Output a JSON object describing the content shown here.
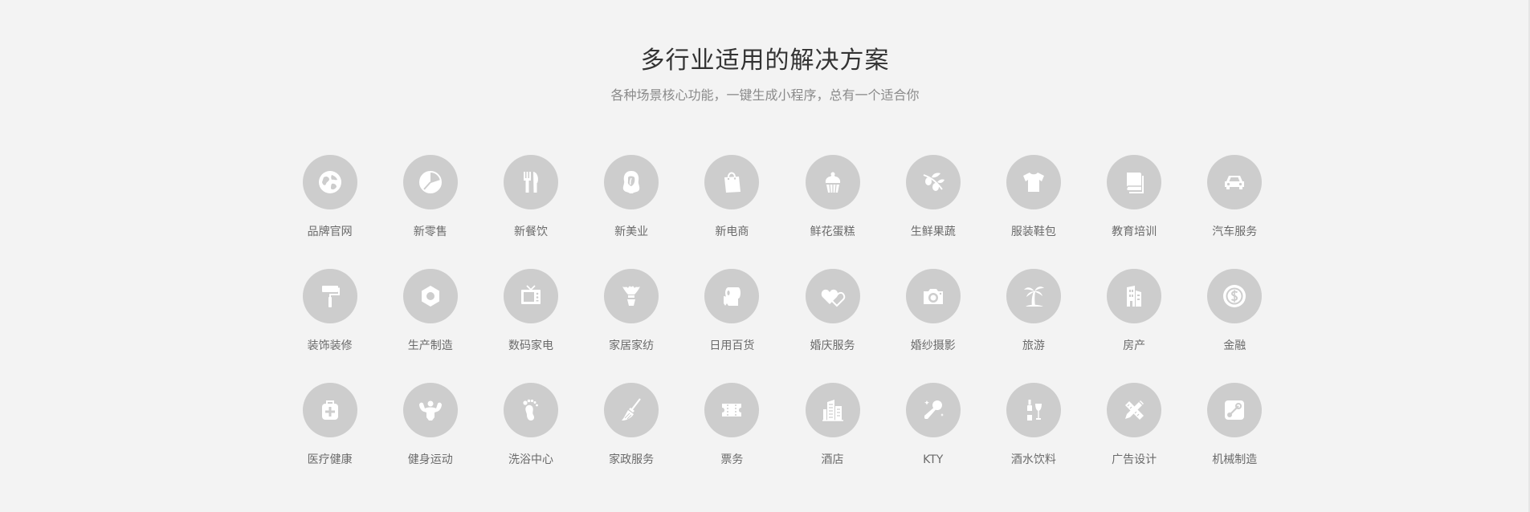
{
  "section": {
    "title": "多行业适用的解决方案",
    "subtitle": "各种场景核心功能，一键生成小程序，总有一个适合你"
  },
  "colors": {
    "background": "#f3f3f3",
    "circle": "#cdcdcd",
    "icon": "#ffffff",
    "title": "#333333",
    "subtitle": "#8a8a8a",
    "label": "#6a6a6a"
  },
  "rows": [
    {
      "items": [
        {
          "label": "品牌官网",
          "icon": "globe-icon"
        },
        {
          "label": "新零售",
          "icon": "pie-chart-icon"
        },
        {
          "label": "新餐饮",
          "icon": "fork-knife-icon"
        },
        {
          "label": "新美业",
          "icon": "woman-hair-icon"
        },
        {
          "label": "新电商",
          "icon": "shopping-bag-icon"
        },
        {
          "label": "鲜花蛋糕",
          "icon": "cupcake-icon"
        },
        {
          "label": "生鲜果蔬",
          "icon": "olive-branch-icon"
        },
        {
          "label": "服装鞋包",
          "icon": "tshirt-icon"
        },
        {
          "label": "教育培训",
          "icon": "book-icon"
        },
        {
          "label": "汽车服务",
          "icon": "car-icon"
        }
      ]
    },
    {
      "items": [
        {
          "label": "装饰装修",
          "icon": "paint-roller-icon"
        },
        {
          "label": "生产制造",
          "icon": "hex-nut-icon"
        },
        {
          "label": "数码家电",
          "icon": "tv-icon"
        },
        {
          "label": "家居家纺",
          "icon": "shuttlecock-icon"
        },
        {
          "label": "日用百货",
          "icon": "paper-roll-icon"
        },
        {
          "label": "婚庆服务",
          "icon": "two-hearts-icon"
        },
        {
          "label": "婚纱摄影",
          "icon": "camera-icon"
        },
        {
          "label": "旅游",
          "icon": "palm-tree-icon"
        },
        {
          "label": "房产",
          "icon": "building-icon"
        },
        {
          "label": "金融",
          "icon": "dollar-coin-icon"
        }
      ]
    },
    {
      "items": [
        {
          "label": "医疗健康",
          "icon": "medical-kit-icon"
        },
        {
          "label": "健身运动",
          "icon": "muscle-man-icon"
        },
        {
          "label": "洗浴中心",
          "icon": "footprint-icon"
        },
        {
          "label": "家政服务",
          "icon": "broom-icon"
        },
        {
          "label": "票务",
          "icon": "ticket-icon"
        },
        {
          "label": "酒店",
          "icon": "hotel-building-icon"
        },
        {
          "label": "KTY",
          "icon": "microphone-icon"
        },
        {
          "label": "酒水饮料",
          "icon": "wine-bottle-glass-icon"
        },
        {
          "label": "广告设计",
          "icon": "pencil-ruler-icon"
        },
        {
          "label": "机械制造",
          "icon": "steam-machine-icon"
        }
      ]
    }
  ]
}
